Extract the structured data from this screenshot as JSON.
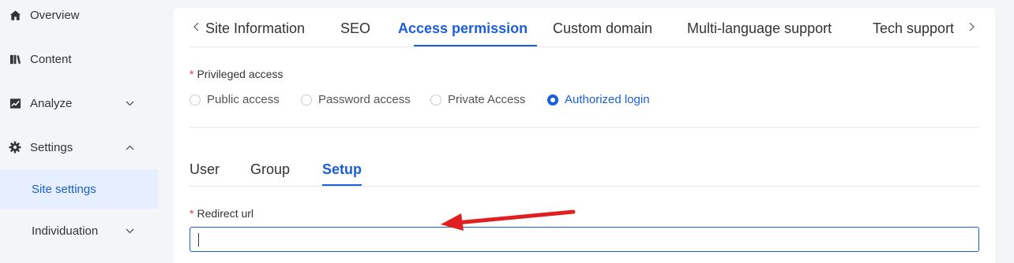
{
  "sidebar": {
    "items": [
      {
        "label": "Overview",
        "icon": "home-icon"
      },
      {
        "label": "Content",
        "icon": "book-icon"
      },
      {
        "label": "Analyze",
        "icon": "chart-icon",
        "expand": "chevron-down"
      },
      {
        "label": "Settings",
        "icon": "gear-icon",
        "expand": "chevron-up"
      },
      {
        "label": "Site settings",
        "active": true
      },
      {
        "label": "Individuation",
        "expand": "chevron-down"
      }
    ]
  },
  "tabs": {
    "items": [
      "Site Information",
      "SEO",
      "Access permission",
      "Custom domain",
      "Multi-language support",
      "Tech support"
    ],
    "active": "Access permission"
  },
  "privileged": {
    "label": "Privileged access",
    "required_mark": "*",
    "options": [
      "Public access",
      "Password access",
      "Private Access",
      "Authorized login"
    ],
    "selected": "Authorized login"
  },
  "subtabs": {
    "items": [
      "User",
      "Group",
      "Setup"
    ],
    "active": "Setup"
  },
  "redirect": {
    "label": "Redirect url",
    "required_mark": "*",
    "value": ""
  },
  "colors": {
    "accent": "#1a5fd7",
    "required": "#e03a3a",
    "annotation_arrow": "#e02020"
  }
}
